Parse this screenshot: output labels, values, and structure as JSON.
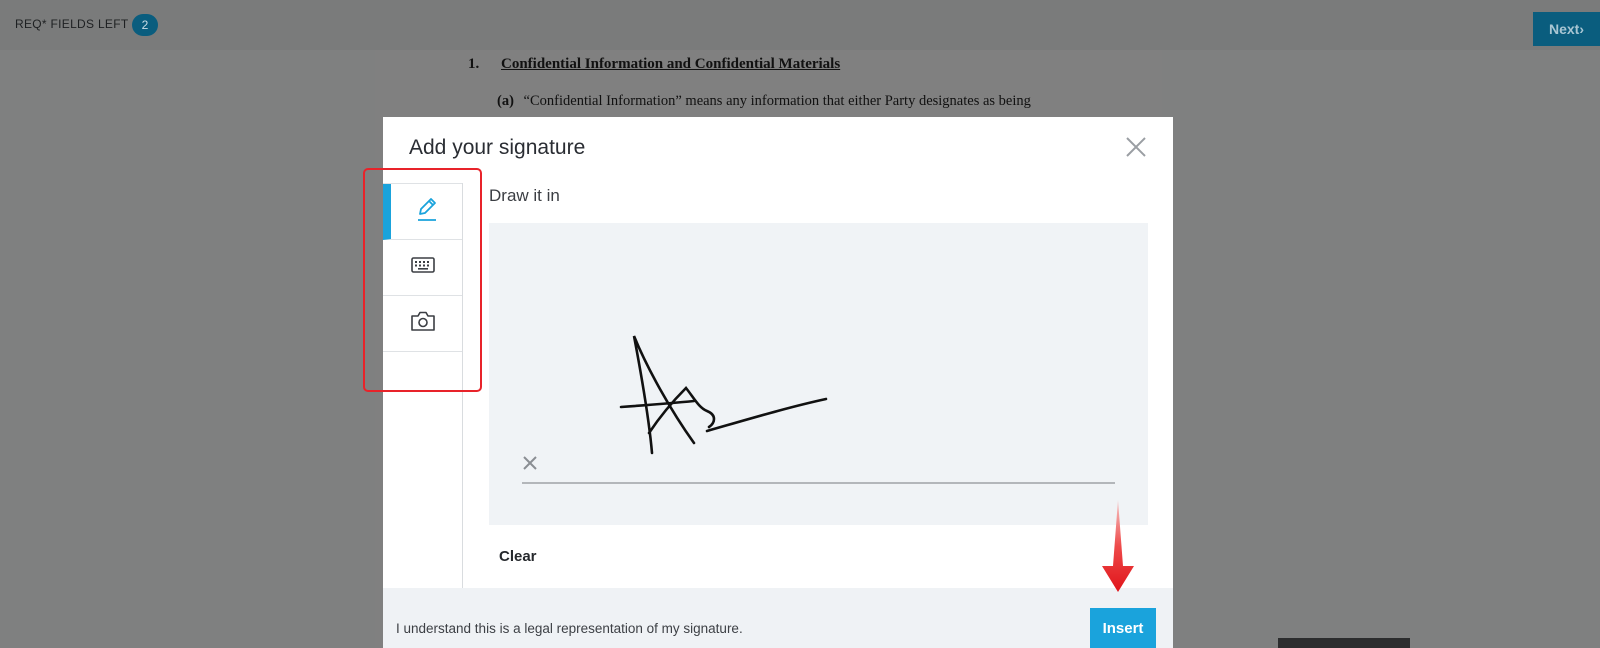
{
  "topbar": {
    "req_label": "REQ* FIELDS LEFT",
    "req_count": "2",
    "next_label": "Next"
  },
  "document": {
    "section_number": "1.",
    "section_title": "Confidential Information and Confidential Materials",
    "para_marker": "(a)",
    "para_text": "“Confidential Information” means any information that either Party designates as being"
  },
  "modal": {
    "title": "Add your signature",
    "section_label": "Draw it in",
    "tabs": [
      {
        "icon": "pencil-icon",
        "active": true
      },
      {
        "icon": "keyboard-icon",
        "active": false
      },
      {
        "icon": "camera-icon",
        "active": false
      }
    ],
    "clear_label": "Clear",
    "footer_text": "I understand this is a legal representation of my signature.",
    "insert_label": "Insert"
  },
  "colors": {
    "accent": "#1aa3dc",
    "annotation": "#e8232a",
    "overlay": "#7f8080"
  }
}
